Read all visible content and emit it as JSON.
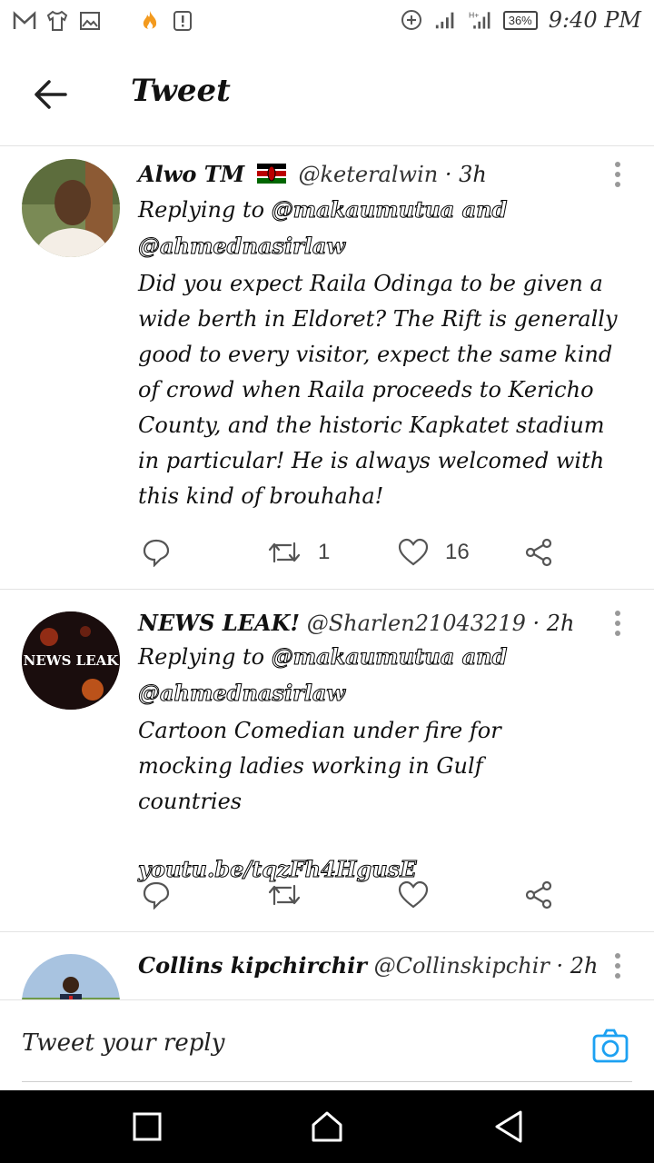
{
  "status_bar": {
    "time": "9:40 PM",
    "battery": "36%",
    "icons_left": [
      "mail-icon",
      "shirt-icon",
      "image-icon",
      "fire-icon",
      "alert-icon"
    ],
    "icons_right": [
      "data-saver-icon",
      "signal-icon",
      "signal-h-icon",
      "battery-icon"
    ]
  },
  "app_bar": {
    "title": "Tweet"
  },
  "tweets": [
    {
      "name": "Alwo TM",
      "handle": "@keteralwin",
      "time": "· 3h",
      "reply_prefix": "Replying to",
      "mention_line1": "@makaumutua and",
      "mention_line2": "@ahmednasirlaw",
      "body": "Did you expect Raila Odinga to be given a wide berth in Eldoret? The Rift is generally good to every visitor, expect the same kind of crowd when Raila proceeds to Kericho County, and the historic Kapkatet stadium in particular! He is always welcomed with this kind of brouhaha!",
      "retweets": "1",
      "likes": "16"
    },
    {
      "name": "NEWS LEAK!",
      "handle": "@Sharlen21043219",
      "time": "· 2h",
      "reply_prefix": "Replying to",
      "mention_line1": "@makaumutua and",
      "mention_line2": "@ahmednasirlaw",
      "body": "Cartoon Comedian under fire for mocking ladies working in Gulf countries",
      "link": "youtu.be/tqzFh4HgusE",
      "avatar_text": "NEWS LEAK"
    },
    {
      "name": "Collins kipchirchir",
      "handle": "@Collinskipchir",
      "time": "· 2h"
    }
  ],
  "compose": {
    "placeholder": "Tweet your reply"
  },
  "colors": {
    "accent": "#1da1f2",
    "icon_gray": "#555555",
    "divider": "#e3e3e3"
  }
}
